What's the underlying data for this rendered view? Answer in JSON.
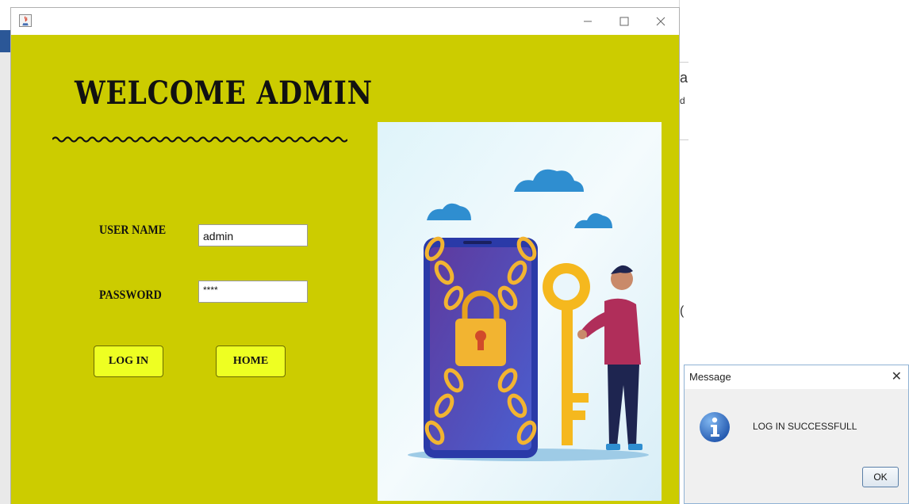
{
  "window": {
    "title": "",
    "controls": [
      "minimize-icon",
      "maximize-icon",
      "close-icon"
    ],
    "background_color": "#cccc00"
  },
  "login": {
    "heading": "WELCOME ADMIN",
    "squiggle": "~~~~~~~~~~~~~~~~~~~~~~~~",
    "username_label": "USER NAME",
    "username_value": "admin",
    "password_label": "PASSWORD",
    "password_value": "****",
    "login_button": "LOG IN",
    "home_button": "HOME",
    "button_color": "#eeff22"
  },
  "dialog": {
    "title": "Message",
    "message": "LOG IN SUCCESSFULL",
    "ok_button": "OK",
    "icon": "info-icon"
  },
  "background_fragments": {
    "frag1": "a",
    "frag2": "d",
    "frag3": "("
  }
}
